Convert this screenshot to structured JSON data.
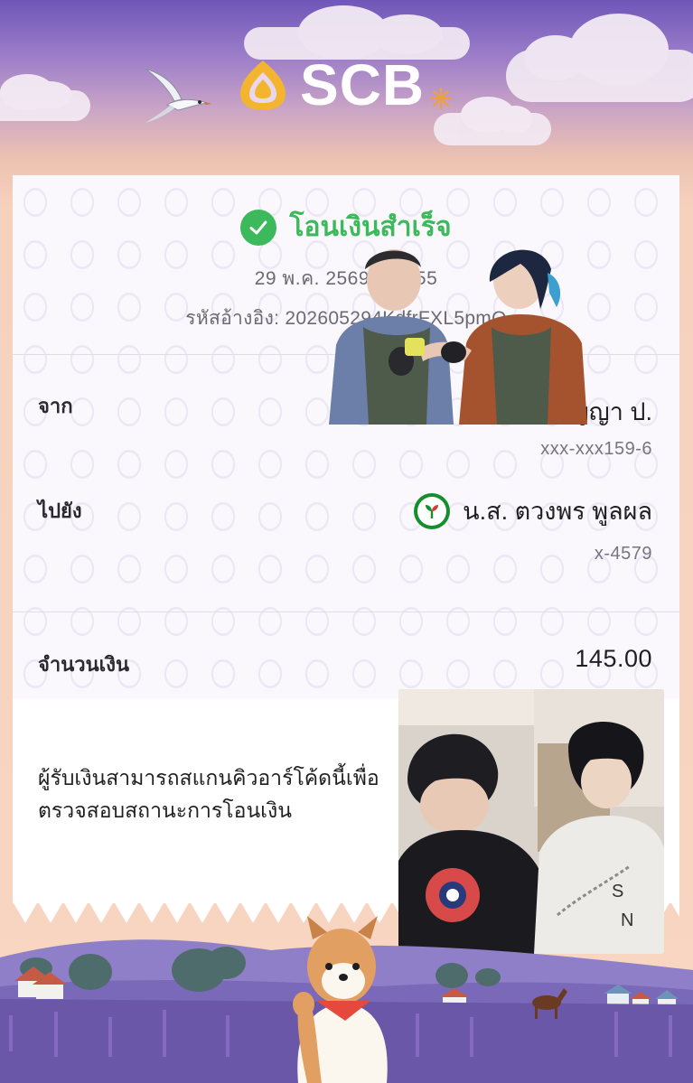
{
  "brand": {
    "logo_text": "SCB",
    "primary_color": "#4e2a84",
    "gold_color": "#f3b52f"
  },
  "receipt": {
    "status": "โอนเงินสำเร็จ",
    "status_color": "#3cb95a",
    "datetime": "29 พ.ค. 2569 - 17:55",
    "reference": "รหัสอ้างอิง: 202605294KdfrFXL5pmO",
    "from": {
      "label": "จาก",
      "name": "นางสาว อัญญา ป.",
      "account": "xxx-xxx159-6"
    },
    "to": {
      "label": "ไปยัง",
      "bank_icon": "kbank-logo-icon",
      "name": "น.ส. ตวงพร พูลผล",
      "account": "x-4579"
    },
    "amount": {
      "label": "จำนวนเงิน",
      "value": "145.00"
    },
    "qr_note": "ผู้รับเงินสามารถสแกนคิวอาร์โค้ดนี้เพื่อตรวจสอบสถานะการโอนเงิน"
  },
  "icons": {
    "success": "check-circle-icon",
    "bird": "tern-bird-icon",
    "star": "sparkle-icon"
  }
}
